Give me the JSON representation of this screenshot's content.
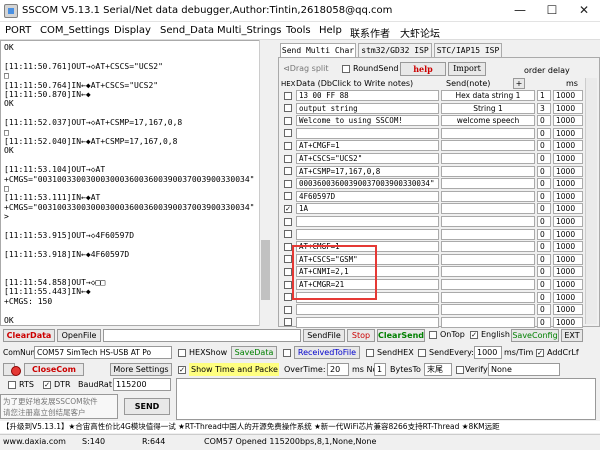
{
  "window": {
    "title": "SSCOM V5.13.1 Serial/Net data debugger,Author:Tintin,2618058@qq.com",
    "min_glyph": "—",
    "max_glyph": "☐",
    "close_glyph": "✕"
  },
  "menu": [
    "PORT",
    "COM_Settings",
    "Display",
    "Send_Data",
    "Multi_Strings",
    "Tools",
    "Help",
    "联系作者",
    "大虾论坛"
  ],
  "receive": [
    "OK",
    "",
    "[11:11:50.761]OUT→◇AT+CSCS=\"UCS2\"",
    "□",
    "[11:11:50.764]IN←◆AT+CSCS=\"UCS2\"",
    "[11:11:50.870]IN←◆",
    "OK",
    "",
    "[11:11:52.037]OUT→◇AT+CSMP=17,167,0,8",
    "□",
    "[11:11:52.040]IN←◆AT+CSMP=17,167,0,8",
    "OK",
    "",
    "[11:11:53.104]OUT→◇AT",
    "+CMGS=\"00310033003000300036003600390037003900330034\"",
    "□",
    "[11:11:53.111]IN←◆AT",
    "+CMGS=\"00310033003000300036003600390037003900330034\"",
    ">",
    "",
    "[11:11:53.915]OUT→◇4F60597D",
    "",
    "[11:11:53.918]IN←◆4F60597D",
    "",
    "",
    "[11:11:54.858]OUT→◇□□",
    "[11:11:55.443]IN←◆",
    "+CMGS: 150",
    "",
    "OK"
  ],
  "tabs": [
    "Send Multi Char",
    "stm32/GD32 ISP",
    "STC/IAP15 ISP"
  ],
  "multi": {
    "drag_split": "⊲Drag split",
    "round_send": "RoundSend",
    "help": "help",
    "import": "Import",
    "order_delay": "order delay",
    "hex_col": "HEX",
    "data_col": "Data (DbClick to Write notes)",
    "send_col": "Send(note)",
    "plus": "+",
    "ms_col": "ms",
    "rows": [
      {
        "data": "13 00 FF 88",
        "note": "Hex data string 1",
        "order": "1",
        "delay": "1000",
        "hex": false
      },
      {
        "data": "output string",
        "note": "String 1",
        "order": "3",
        "delay": "1000",
        "hex": false
      },
      {
        "data": "Welcome to using SSCOM!",
        "note": "welcome speech",
        "order": "0",
        "delay": "1000",
        "hex": false
      },
      {
        "data": "",
        "note": "",
        "order": "0",
        "delay": "1000",
        "hex": false
      },
      {
        "data": "AT+CMGF=1",
        "note": "",
        "order": "0",
        "delay": "1000",
        "hex": false
      },
      {
        "data": "AT+CSCS=\"UCS2\"",
        "note": "",
        "order": "0",
        "delay": "1000",
        "hex": false
      },
      {
        "data": "AT+CSMP=17,167,0,8",
        "note": "",
        "order": "0",
        "delay": "1000",
        "hex": false
      },
      {
        "data": "00036003600390037003900330034\"",
        "note": "",
        "order": "0",
        "delay": "1000",
        "hex": false
      },
      {
        "data": "4F60597D",
        "note": "",
        "order": "0",
        "delay": "1000",
        "hex": false
      },
      {
        "data": "1A",
        "note": "",
        "order": "0",
        "delay": "1000",
        "hex": true
      },
      {
        "data": "",
        "note": "",
        "order": "0",
        "delay": "1000",
        "hex": false
      },
      {
        "data": "",
        "note": "",
        "order": "0",
        "delay": "1000",
        "hex": false
      },
      {
        "data": "AT+CMGF=1",
        "note": "",
        "order": "0",
        "delay": "1000",
        "hex": false
      },
      {
        "data": "AT+CSCS=\"GSM\"",
        "note": "",
        "order": "0",
        "delay": "1000",
        "hex": false
      },
      {
        "data": "AT+CNMI=2,1",
        "note": "",
        "order": "0",
        "delay": "1000",
        "hex": false
      },
      {
        "data": "AT+CMGR=21",
        "note": "",
        "order": "0",
        "delay": "1000",
        "hex": false
      },
      {
        "data": "",
        "note": "",
        "order": "0",
        "delay": "1000",
        "hex": false
      },
      {
        "data": "",
        "note": "",
        "order": "0",
        "delay": "1000",
        "hex": false
      },
      {
        "data": "",
        "note": "",
        "order": "0",
        "delay": "1000",
        "hex": false
      }
    ]
  },
  "row1": {
    "clear_data": "ClearData",
    "open_file": "OpenFile",
    "send_file": "SendFile",
    "stop": "Stop",
    "clear_send": "ClearSend",
    "on_top": "OnTop",
    "english": "English",
    "save_config": "SaveConfig",
    "ext": "EXT"
  },
  "row2": {
    "comnum_label": "ComNum",
    "com_value": "COM57 SimTech HS-USB AT Po",
    "hexshow": "HEXShow",
    "savedata": "SaveData",
    "received_to_file": "ReceivedToFile",
    "sendhex": "SendHEX",
    "send_every": "SendEvery:",
    "send_every_value": "1000",
    "ms_tim": "ms/Tim",
    "add_crlf": "AddCrLf"
  },
  "row3": {
    "close_com": "CloseCom",
    "more_settings": "More Settings",
    "show_time": "Show Time and Packe",
    "over_time": "OverTime:",
    "over_time_value": "20",
    "ms_no": "ms No",
    "no_value": "1",
    "bytes_to": "BytesTo",
    "tail": "末尾",
    "verify": "Verify",
    "verify_value": "None"
  },
  "row4": {
    "rts": "RTS",
    "dtr": "DTR",
    "baud_label": "BaudRat",
    "baud_value": "115200"
  },
  "promo": {
    "line1": "为了更好地发展SSCOM软件",
    "line2": "请您注册嘉立创结尾客户",
    "send": "SEND"
  },
  "ticker": "【升级到V5.13.1】★合宙高性价比4G模块值得一试 ★RT-Thread中国人的开源免费操作系统 ★新一代WiFi芯片兼容8266支持RT-Thread ★8KM远距",
  "status": {
    "site": "www.daxia.com",
    "s": "S:140",
    "r": "R:644",
    "port": "COM57 Opened  115200bps,8,1,None,None"
  },
  "colors": {
    "red_accent": "#e53935",
    "link_green": "#008000",
    "help_red": "#cc0000"
  }
}
